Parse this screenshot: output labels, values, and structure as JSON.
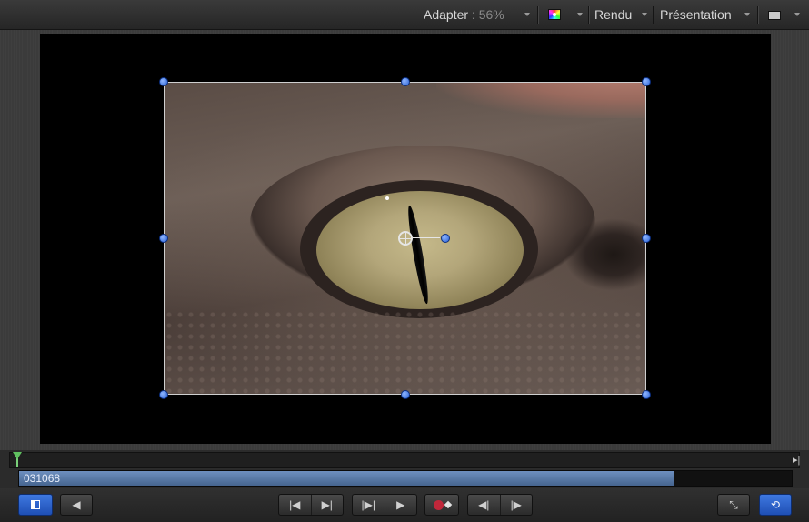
{
  "toolbar": {
    "adapter_label": "Adapter",
    "adapter_value": " : 56%",
    "color_icon": "color-channels-icon",
    "rendu_label": "Rendu",
    "presentation_label": "Présentation",
    "view_icon": "view-layout-icon"
  },
  "canvas": {
    "image_icon": "crocodile-eye-image",
    "selected_layer_handles": "transform-handles"
  },
  "timeline": {
    "range_label": "031068",
    "range_fraction": 0.848
  },
  "transport": {
    "buttons": [
      {
        "name": "toggle-layers-icon",
        "label": ""
      },
      {
        "name": "audio-icon",
        "label": ""
      },
      {
        "name": "go-to-start-icon",
        "label": "|◀"
      },
      {
        "name": "go-to-end-icon",
        "label": "▶|"
      },
      {
        "name": "step-back-icon",
        "label": "|▶|"
      },
      {
        "name": "play-icon",
        "label": "▶"
      },
      {
        "name": "record-icon",
        "label": ""
      },
      {
        "name": "previous-frame-icon",
        "label": "◀|"
      },
      {
        "name": "next-frame-icon",
        "label": "|▶"
      },
      {
        "name": "fullscreen-icon",
        "label": ""
      },
      {
        "name": "loop-icon",
        "label": ""
      }
    ]
  },
  "colors": {
    "accent_blue": "#2a62d6",
    "record_red": "#c0273a",
    "playhead_green": "#60c060",
    "range_blue": "#5b7cab"
  }
}
